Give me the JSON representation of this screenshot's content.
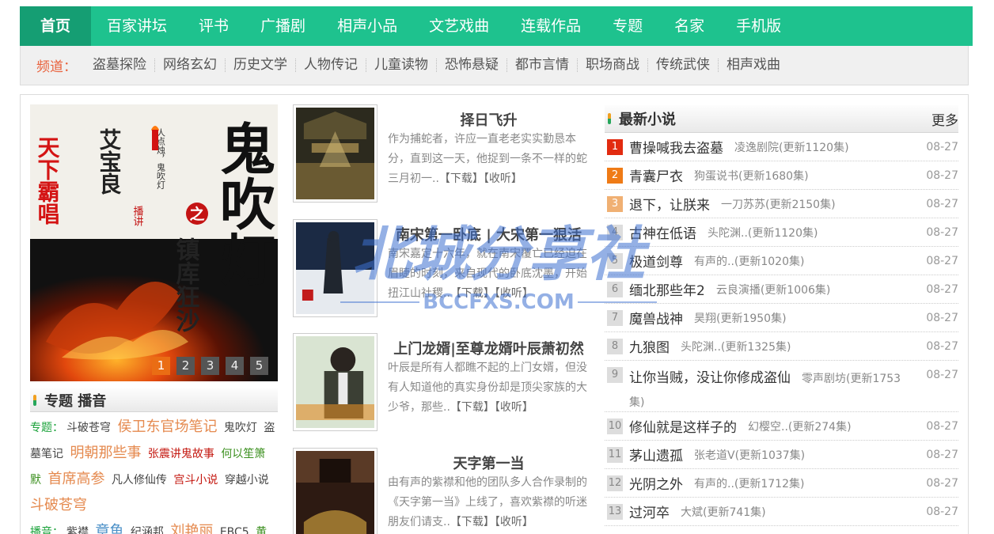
{
  "topnav": {
    "items": [
      "首页",
      "百家讲坛",
      "评书",
      "广播剧",
      "相声小品",
      "文艺戏曲",
      "连载作品",
      "专题",
      "名家",
      "手机版"
    ]
  },
  "channels": {
    "label": "频道：",
    "items": [
      "盗墓探险",
      "网络玄幻",
      "历史文学",
      "人物传记",
      "儿童读物",
      "恐怖悬疑",
      "都市言情",
      "职场商战",
      "传统武侠",
      "相声戏曲"
    ]
  },
  "slider": {
    "cover_title": "鬼吹灯",
    "cover_subtitle": "镇库狂沙",
    "cover_author": "艾宝良",
    "cover_series": "天下霸唱",
    "cover_tag": "播讲",
    "cover_word": "之",
    "cover_tagline": "人点烛，鬼吹灯",
    "pages": [
      "1",
      "2",
      "3",
      "4",
      "5"
    ],
    "active_page": "1"
  },
  "topics": {
    "title": "专题 播音",
    "label_topic": "专题：",
    "label_host": "播音：",
    "topic_items": [
      "斗破苍穹",
      "侯卫东官场笔记",
      "鬼吹灯",
      "盗墓笔记",
      "明朝那些事",
      "张震讲鬼故事",
      "何以笙箫默",
      "首席高参",
      "凡人修仙传",
      "宫斗小说",
      "穿越小说",
      "斗破苍穹"
    ],
    "host_items": [
      "紫襟",
      "章鱼",
      "纪涵邦",
      "刘艳丽",
      "EBC5",
      "黄"
    ]
  },
  "books": [
    {
      "title": "择日飞升",
      "desc": "作为捕蛇者，许应一直老老实实勤恳本分，直到这一天，他捉到一条不一样的蛇 三月初一..",
      "download": "【下载】",
      "listen": "【收听】"
    },
    {
      "title": "南宋第一卧底 | 大宋第一狠活",
      "desc": "南宋嘉定十六年，就在南宋覆亡已经迫在眉睫的时刻，来自现代的卧底沈墨，开始扭江山社稷..",
      "download": "【下载】",
      "listen": "【收听】"
    },
    {
      "title": "上门龙婿|至尊龙婿叶辰萧初然",
      "desc": "叶辰是所有人都瞧不起的上门女婿，但没有人知道他的真实身份却是顶尖家族的大少爷，那些..",
      "download": "【下载】",
      "listen": "【收听】"
    },
    {
      "title": "天字第一当",
      "desc": "由有声的紫襟和他的团队多人合作录制的《天字第一当》上线了，喜欢紫襟的听迷朋友们请支..",
      "download": "【下载】",
      "listen": "【收听】"
    }
  ],
  "latest": {
    "title": "最新小说",
    "more": "更多",
    "rows": [
      {
        "num": "1",
        "name": "曹操喊我去盗墓",
        "meta": "凌逸剧院(更新1120集)",
        "date": "08-27"
      },
      {
        "num": "2",
        "name": "青囊尸衣",
        "meta": "狗蛋说书(更新1680集)",
        "date": "08-27"
      },
      {
        "num": "3",
        "name": "退下，让朕来",
        "meta": "一刀苏苏(更新2150集)",
        "date": "08-27"
      },
      {
        "num": "4",
        "name": "古神在低语",
        "meta": "头陀渊..(更新1120集)",
        "date": "08-27"
      },
      {
        "num": "5",
        "name": "极道剑尊",
        "meta": "有声的..(更新1020集)",
        "date": "08-27"
      },
      {
        "num": "6",
        "name": "缅北那些年2",
        "meta": "云良演播(更新1006集)",
        "date": "08-27"
      },
      {
        "num": "7",
        "name": "魔兽战神",
        "meta": "昊翔(更新1950集)",
        "date": "08-27"
      },
      {
        "num": "8",
        "name": "九狼图",
        "meta": "头陀渊..(更新1325集)",
        "date": "08-27"
      },
      {
        "num": "9",
        "name": "让你当贼，没让你修成盗仙",
        "meta": "零声剧坊(更新1753集)",
        "date": "08-27"
      },
      {
        "num": "10",
        "name": "修仙就是这样子的",
        "meta": "幻樱空..(更新274集)",
        "date": "08-27"
      },
      {
        "num": "11",
        "name": "茅山遗孤",
        "meta": "张老道V(更新1037集)",
        "date": "08-27"
      },
      {
        "num": "12",
        "name": "光阴之外",
        "meta": "有声的..(更新1712集)",
        "date": "08-27"
      },
      {
        "num": "13",
        "name": "过河卒",
        "meta": "大斌(更新741集)",
        "date": "08-27"
      }
    ]
  },
  "watermark": {
    "main": "北城分享社",
    "url": "BCCFXS.COM"
  },
  "colors": {
    "nav_green": "#1ec28e",
    "nav_active": "#159e73",
    "accent_orange": "#e9613c",
    "rank1": "#e22b10",
    "rank2": "#ef7b16",
    "rank3": "#f0b073"
  }
}
